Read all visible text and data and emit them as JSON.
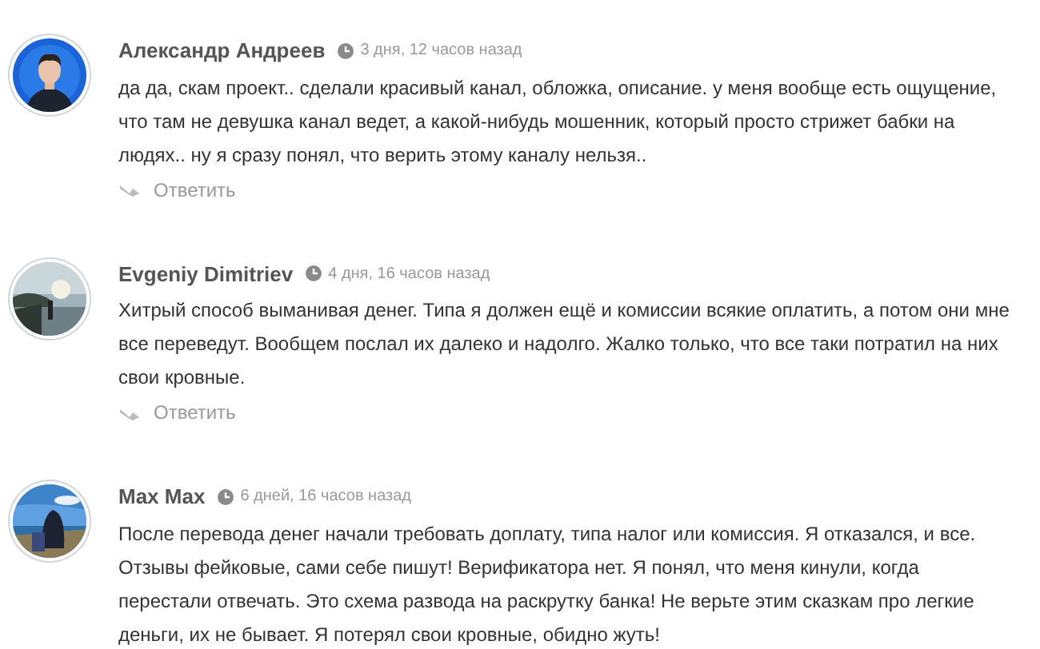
{
  "comments": [
    {
      "author": "Александр Андреев",
      "time": "3 дня, 12 часов назад",
      "text": "да да, скам проект.. сделали красивый канал, обложка, описание. у меня вообще есть ощущение, что там не девушка канал ведет, а какой-нибудь мошенник, который просто стрижет бабки на людях.. ну я сразу понял, что верить этому каналу нельзя..",
      "reply": "Ответить"
    },
    {
      "author": "Evgeniy Dimitriev",
      "time": "4 дня, 16 часов назад",
      "text": "Хитрый способ выманивая денег. Типа я должен ещё и комиссии всякие оплатить, а потом они мне все переведут. Вообщем послал их далеко и надолго. Жалко только, что все таки потратил на них свои кровные.",
      "reply": "Ответить"
    },
    {
      "author": "Max Max",
      "time": "6 дней, 16 часов назад",
      "text": "После перевода денег начали требовать доплату, типа налог или комиссия. Я отказался, и все. Отзывы фейковые, сами себе пишут! Верификатора нет. Я понял, что меня кинули, когда перестали отвечать. Это схема развода на раскрутку банка! Не верьте этим сказкам про легкие деньги, их не бывает. Я потерял свои кровные, обидно жуть!"
    }
  ]
}
